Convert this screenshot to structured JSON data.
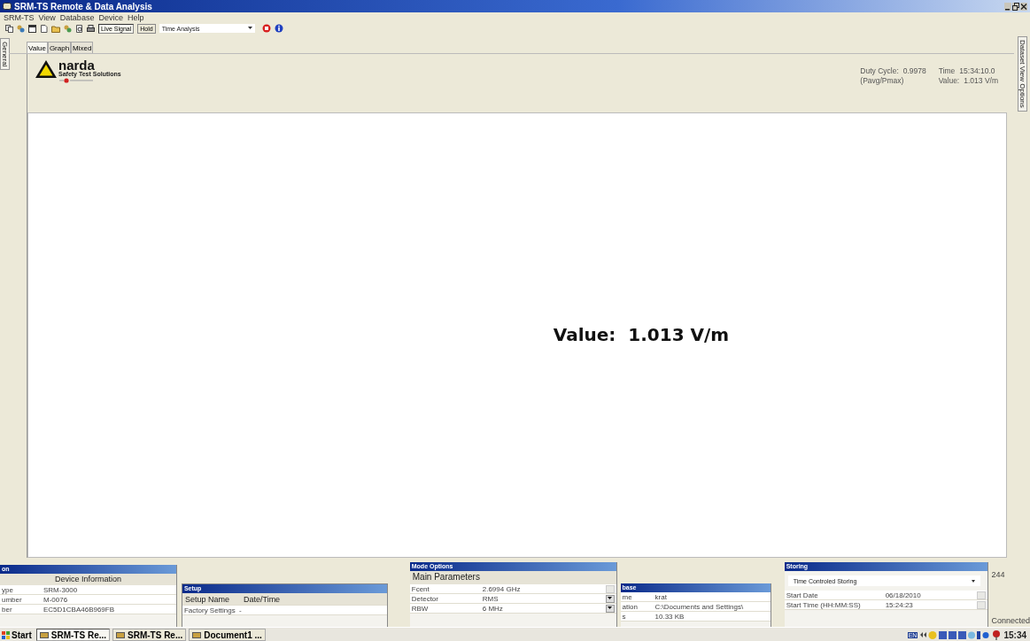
{
  "window": {
    "title": "SRM-TS Remote & Data Analysis"
  },
  "menu": [
    "SRM-TS",
    "View",
    "Database",
    "Device",
    "Help"
  ],
  "toolbar": {
    "toggles": [
      {
        "label": "Live Signal",
        "selected": true
      },
      {
        "label": "Hold",
        "selected": false
      }
    ],
    "mode_select": {
      "value": "Time Analysis"
    }
  },
  "side_tabs": {
    "left": "General",
    "right": "Dataset View Options"
  },
  "tabs": [
    {
      "label": "Value",
      "selected": true
    },
    {
      "label": "Graph",
      "selected": false
    },
    {
      "label": "Mixed",
      "selected": false
    }
  ],
  "logo": {
    "name": "narda",
    "tagline": "Safety Test Solutions"
  },
  "readouts": {
    "duty_label": "Duty Cycle:",
    "duty_sub": "(Pavg/Pmax)",
    "duty_value": "0.9978",
    "time_label": "Time",
    "time_value": "15:34:10.0",
    "value_label": "Value:",
    "value_value": "1.013 V/m"
  },
  "big_value": {
    "label": "Value:",
    "value": "1.013 V/m"
  },
  "device_panel": {
    "title": "on",
    "header": "Device Information",
    "rows": [
      [
        "ype",
        "SRM-3000"
      ],
      [
        "umber",
        "M-0076"
      ],
      [
        "ber",
        "EC5D1CBA46B969FB"
      ]
    ]
  },
  "setup_panel": {
    "title": "Setup",
    "columns": [
      "Setup Name",
      "Date/Time"
    ],
    "rows": [
      [
        "Factory Settings",
        "-"
      ]
    ]
  },
  "mode_panel": {
    "title": "Mode Options",
    "header": "Main Parameters",
    "rows": [
      {
        "name": "Fcent",
        "value": "2.6994 GHz",
        "disabled": true
      },
      {
        "name": "Detector",
        "value": "RMS",
        "disabled": false
      },
      {
        "name": "RBW",
        "value": "6 MHz",
        "disabled": false
      }
    ]
  },
  "database_panel": {
    "title": "base",
    "rows": [
      [
        "me",
        "krat"
      ],
      [
        "ation",
        "C:\\Documents and Settings\\"
      ],
      [
        "s",
        "10.33 KB"
      ]
    ]
  },
  "storing_panel": {
    "title": "Storing",
    "mode": "Time Controled Storing",
    "rows": [
      {
        "name": "Start Date",
        "value": "06/18/2010"
      },
      {
        "name": "Start Time (HH:MM:SS)",
        "value": "15:24:23"
      }
    ]
  },
  "status": {
    "count": "244",
    "connection": "Connected"
  },
  "taskbar": {
    "start": "Start",
    "tasks": [
      {
        "label": "SRM-TS Re...",
        "selected": true
      },
      {
        "label": "SRM-TS Re...",
        "selected": false
      },
      {
        "label": "Document1 ...",
        "selected": false
      }
    ],
    "language": "EN",
    "clock": "15:34"
  }
}
